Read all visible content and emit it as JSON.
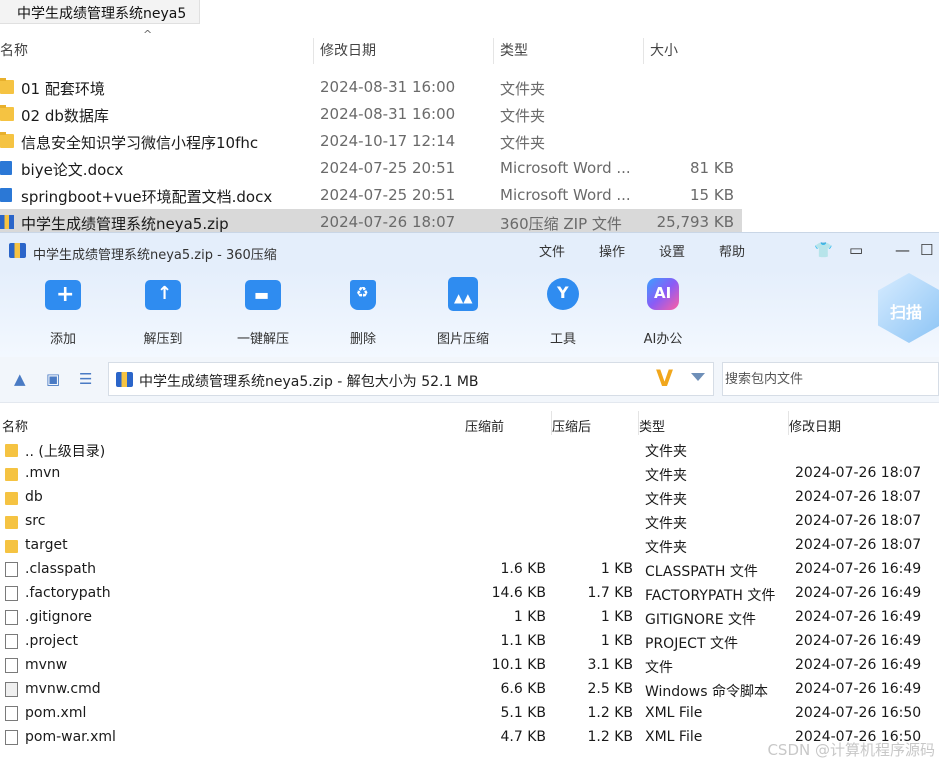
{
  "explorer": {
    "address": "中学生成绩管理系统neya5",
    "columns": {
      "name": "名称",
      "date": "修改日期",
      "type": "类型",
      "size": "大小"
    },
    "rows": [
      {
        "icon": "folder",
        "name": "01 配套环境",
        "date": "2024-08-31 16:00",
        "type": "文件夹",
        "size": ""
      },
      {
        "icon": "folder",
        "name": "02 db数据库",
        "date": "2024-08-31 16:00",
        "type": "文件夹",
        "size": ""
      },
      {
        "icon": "folder",
        "name": "信息安全知识学习微信小程序10fhc",
        "date": "2024-10-17 12:14",
        "type": "文件夹",
        "size": ""
      },
      {
        "icon": "docx",
        "name": "biye论文.docx",
        "date": "2024-07-25 20:51",
        "type": "Microsoft Word ...",
        "size": "81 KB"
      },
      {
        "icon": "docx",
        "name": "springboot+vue环境配置文档.docx",
        "date": "2024-07-25 20:51",
        "type": "Microsoft Word ...",
        "size": "15 KB"
      },
      {
        "icon": "zip",
        "name": "中学生成绩管理系统neya5.zip",
        "date": "2024-07-26 18:07",
        "type": "360压缩 ZIP 文件",
        "size": "25,793 KB"
      }
    ]
  },
  "zip_window": {
    "title": "中学生成绩管理系统neya5.zip - 360压缩",
    "menu": [
      "文件",
      "操作",
      "设置",
      "帮助"
    ],
    "toolbar": [
      {
        "icon": "add-icon",
        "label": "添加"
      },
      {
        "icon": "extract-icon",
        "label": "解压到"
      },
      {
        "icon": "one-click-extract-icon",
        "label": "一键解压"
      },
      {
        "icon": "delete-icon",
        "label": "删除"
      },
      {
        "icon": "image-compress-icon",
        "label": "图片压缩"
      },
      {
        "icon": "tools-icon",
        "label": "工具"
      },
      {
        "icon": "ai-office-icon",
        "label": "AI办公"
      }
    ],
    "scan_label": "扫描",
    "path_text": "中学生成绩管理系统neya5.zip - 解包大小为 52.1 MB",
    "search_placeholder": "搜索包内文件",
    "columns": {
      "name": "名称",
      "before": "压缩前",
      "after": "压缩后",
      "type": "类型",
      "modified": "修改日期"
    },
    "rows": [
      {
        "icon": "folder",
        "name": ".. (上级目录)",
        "before": "",
        "after": "",
        "type": "文件夹",
        "modified": ""
      },
      {
        "icon": "folder",
        "name": ".mvn",
        "before": "",
        "after": "",
        "type": "文件夹",
        "modified": "2024-07-26 18:07"
      },
      {
        "icon": "folder",
        "name": "db",
        "before": "",
        "after": "",
        "type": "文件夹",
        "modified": "2024-07-26 18:07"
      },
      {
        "icon": "folder",
        "name": "src",
        "before": "",
        "after": "",
        "type": "文件夹",
        "modified": "2024-07-26 18:07"
      },
      {
        "icon": "folder",
        "name": "target",
        "before": "",
        "after": "",
        "type": "文件夹",
        "modified": "2024-07-26 18:07"
      },
      {
        "icon": "file",
        "name": ".classpath",
        "before": "1.6 KB",
        "after": "1 KB",
        "type": "CLASSPATH 文件",
        "modified": "2024-07-26 16:49"
      },
      {
        "icon": "file",
        "name": ".factorypath",
        "before": "14.6 KB",
        "after": "1.7 KB",
        "type": "FACTORYPATH 文件",
        "modified": "2024-07-26 16:49"
      },
      {
        "icon": "file",
        "name": ".gitignore",
        "before": "1 KB",
        "after": "1 KB",
        "type": "GITIGNORE 文件",
        "modified": "2024-07-26 16:49"
      },
      {
        "icon": "file",
        "name": ".project",
        "before": "1.1 KB",
        "after": "1 KB",
        "type": "PROJECT 文件",
        "modified": "2024-07-26 16:49"
      },
      {
        "icon": "file",
        "name": "mvnw",
        "before": "10.1 KB",
        "after": "3.1 KB",
        "type": "文件",
        "modified": "2024-07-26 16:49"
      },
      {
        "icon": "cmd",
        "name": "mvnw.cmd",
        "before": "6.6 KB",
        "after": "2.5 KB",
        "type": "Windows 命令脚本",
        "modified": "2024-07-26 16:49"
      },
      {
        "icon": "file",
        "name": "pom.xml",
        "before": "5.1 KB",
        "after": "1.2 KB",
        "type": "XML File",
        "modified": "2024-07-26 16:50"
      },
      {
        "icon": "file",
        "name": "pom-war.xml",
        "before": "4.7 KB",
        "after": "1.2 KB",
        "type": "XML File",
        "modified": "2024-07-26 16:50"
      }
    ]
  },
  "watermark": "CSDN @计算机程序源码"
}
